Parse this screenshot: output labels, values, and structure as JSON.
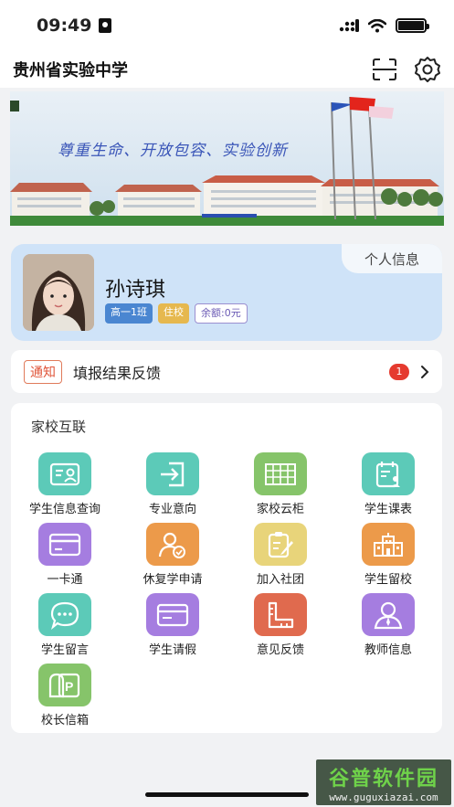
{
  "status_bar": {
    "time": "09:49"
  },
  "header": {
    "title": "贵州省实验中学"
  },
  "banner": {
    "slogan": "尊重生命、开放包容、实验创新"
  },
  "profile": {
    "tab_label": "个人信息",
    "name": "孙诗琪",
    "class_tag": "高一1班",
    "board_tag": "住校",
    "balance_tag": "余额:0元"
  },
  "notice": {
    "tag": "通知",
    "text": "填报结果反馈",
    "count": "1"
  },
  "services": {
    "title": "家校互联",
    "items": [
      {
        "label": "学生信息查询",
        "icon": "id-card-icon",
        "color": "#5ccab8"
      },
      {
        "label": "专业意向",
        "icon": "login-arrow-icon",
        "color": "#5ccab8"
      },
      {
        "label": "家校云柜",
        "icon": "cabinet-icon",
        "color": "#86c46a"
      },
      {
        "label": "学生课表",
        "icon": "schedule-icon",
        "color": "#5ccab8"
      },
      {
        "label": "一卡通",
        "icon": "card-icon",
        "color": "#a57de0"
      },
      {
        "label": "休复学申请",
        "icon": "user-check-icon",
        "color": "#ec9a4a"
      },
      {
        "label": "加入社团",
        "icon": "clipboard-edit-icon",
        "color": "#e8d47a"
      },
      {
        "label": "学生留校",
        "icon": "school-building-icon",
        "color": "#ec9a4a"
      },
      {
        "label": "学生留言",
        "icon": "chat-bubble-icon",
        "color": "#5ccab8"
      },
      {
        "label": "学生请假",
        "icon": "form-icon",
        "color": "#a57de0"
      },
      {
        "label": "意见反馈",
        "icon": "ruler-icon",
        "color": "#e06a4e"
      },
      {
        "label": "教师信息",
        "icon": "teacher-icon",
        "color": "#a57de0"
      },
      {
        "label": "校长信箱",
        "icon": "mailbox-icon",
        "color": "#86c46a"
      }
    ]
  },
  "watermark": {
    "main": "谷普软件园",
    "sub": "www.guguxiazai.com"
  }
}
